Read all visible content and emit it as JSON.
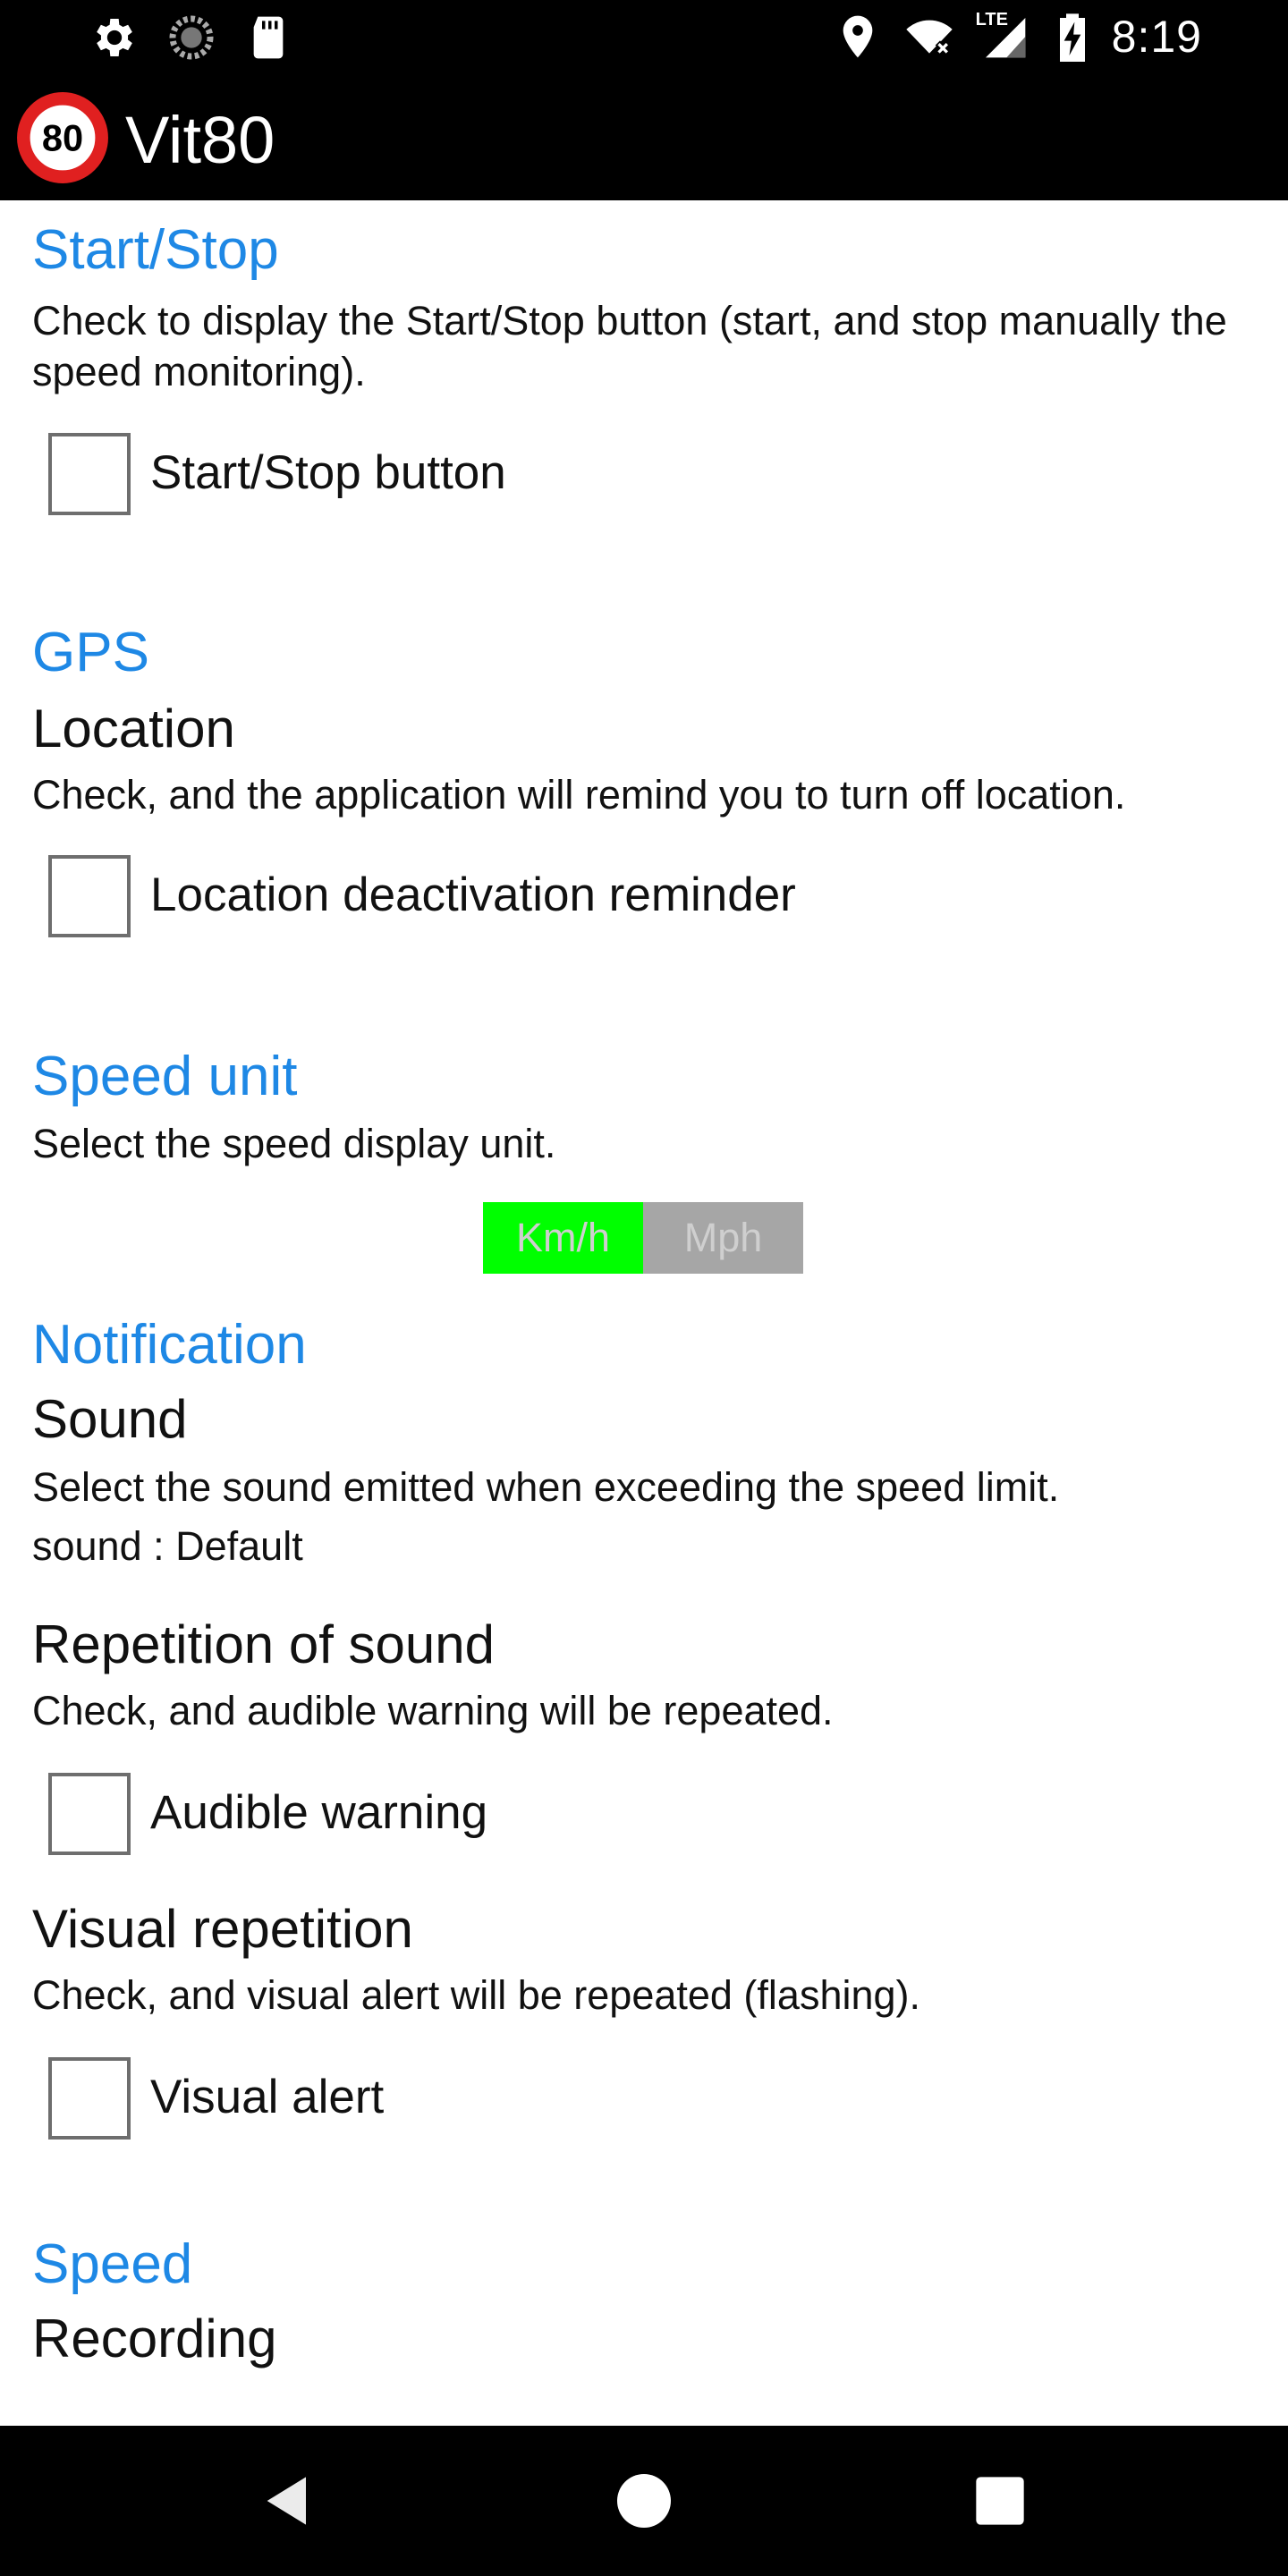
{
  "status_bar": {
    "time": "8:19",
    "left_icons": [
      "gear-icon",
      "sync-icon",
      "sd-card-icon"
    ],
    "right_icons": [
      "location-pin-icon",
      "wifi-icon",
      "lte-signal-icon",
      "battery-charging-icon"
    ],
    "lte_label": "LTE"
  },
  "app_bar": {
    "logo_text": "80",
    "title": "Vit80"
  },
  "sections": {
    "start_stop": {
      "title": "Start/Stop",
      "summary": "Check to display the Start/Stop button (start, and stop manually the speed monitoring).",
      "checkbox_label": "Start/Stop button",
      "checked": false
    },
    "gps": {
      "title": "GPS",
      "pref_title": "Location",
      "summary": "Check, and the application will remind you to turn off location.",
      "checkbox_label": "Location deactivation reminder",
      "checked": false
    },
    "speed_unit": {
      "title": "Speed unit",
      "summary": "Select the speed display unit.",
      "options": [
        "Km/h",
        "Mph"
      ],
      "selected": "Km/h"
    },
    "notification": {
      "title": "Notification",
      "sound_title": "Sound",
      "sound_summary": "Select the sound emitted when exceeding the speed limit.",
      "sound_value": "sound : Default",
      "repetition_title": "Repetition of sound",
      "repetition_summary": "Check, and audible warning will be repeated.",
      "audible_label": "Audible warning",
      "audible_checked": false,
      "visual_title": "Visual repetition",
      "visual_summary": "Check, and visual alert will be repeated (flashing).",
      "visual_label": "Visual alert",
      "visual_checked": false
    },
    "speed": {
      "title": "Speed",
      "recording_title": "Recording"
    }
  },
  "colors": {
    "accent": "#1e88e5",
    "toggle_on": "#00ff00",
    "toggle_off": "#a6a6a6",
    "bar": "#000000"
  },
  "nav_bar": {
    "buttons": [
      "back-icon",
      "home-icon",
      "recents-icon"
    ]
  }
}
